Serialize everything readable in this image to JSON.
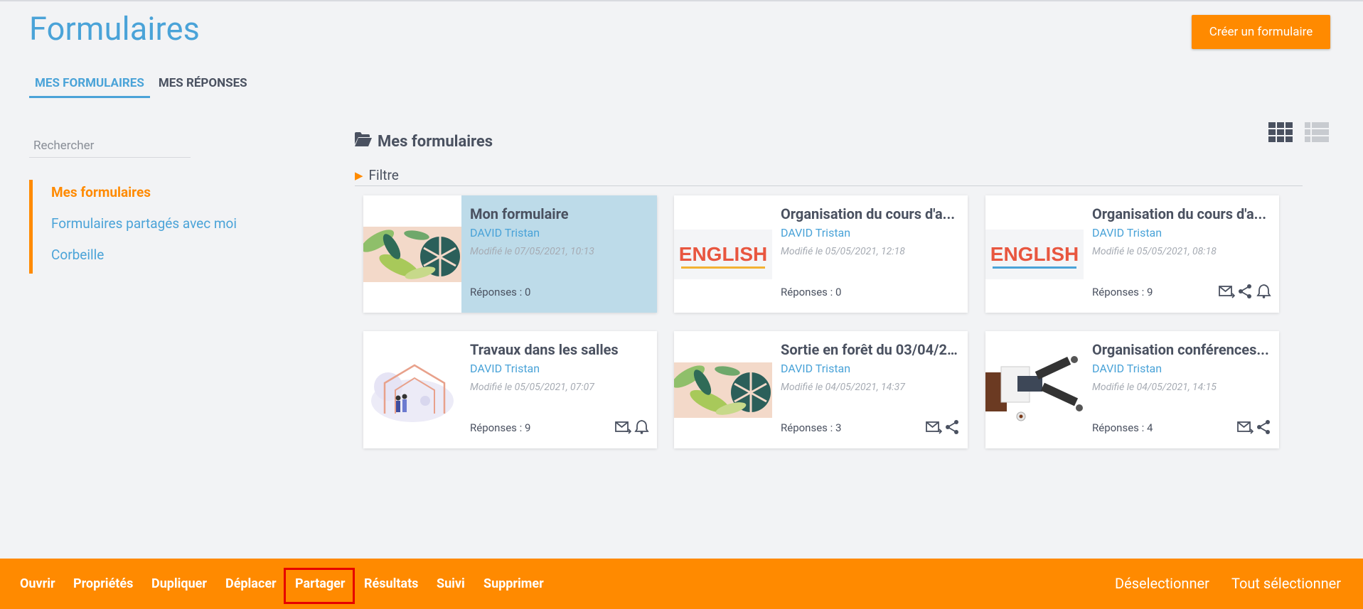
{
  "page": {
    "title": "Formulaires",
    "create_button": "Créer un formulaire"
  },
  "tabs": [
    {
      "label": "MES FORMULAIRES",
      "active": true
    },
    {
      "label": "MES RÉPONSES",
      "active": false
    }
  ],
  "search": {
    "placeholder": "Rechercher",
    "value": ""
  },
  "sidebar": {
    "items": [
      {
        "label": "Mes formulaires",
        "active": true
      },
      {
        "label": "Formulaires partagés avec moi",
        "active": false
      },
      {
        "label": "Corbeille",
        "active": false
      }
    ]
  },
  "main": {
    "section_title": "Mes formulaires",
    "filter_label": "Filtre",
    "view_modes": [
      "grid-view-icon",
      "list-view-icon"
    ],
    "cards": [
      {
        "title": "Mon formulaire",
        "author": "DAVID Tristan",
        "modified": "Modifié le 07/05/2021, 10:13",
        "responses": "Réponses : 0",
        "thumbnail": "tropical-leaves",
        "selected": true,
        "icons": []
      },
      {
        "title": "Organisation du cours d'a...",
        "author": "DAVID Tristan",
        "modified": "Modifié le 05/05/2021, 12:18",
        "responses": "Réponses : 0",
        "thumbnail": "english-word",
        "thumbnail_text": "ENGLISH",
        "selected": false,
        "icons": []
      },
      {
        "title": "Organisation du cours d'a...",
        "author": "DAVID Tristan",
        "modified": "Modifié le 05/05/2021, 08:18",
        "responses": "Réponses : 9",
        "thumbnail": "english-word",
        "thumbnail_text": "ENGLISH",
        "selected": false,
        "icons": [
          "mail-icon",
          "share-icon",
          "bell-icon"
        ]
      },
      {
        "title": "Travaux dans les salles",
        "author": "DAVID Tristan",
        "modified": "Modifié le 05/05/2021, 07:07",
        "responses": "Réponses : 9",
        "thumbnail": "house-illustration",
        "selected": false,
        "icons": [
          "mail-icon",
          "bell-icon"
        ]
      },
      {
        "title": "Sortie en forêt du 03/04/2...",
        "author": "DAVID Tristan",
        "modified": "Modifié le 04/05/2021, 14:37",
        "responses": "Réponses : 3",
        "thumbnail": "tropical-leaves",
        "selected": false,
        "icons": [
          "mail-icon",
          "share-icon"
        ]
      },
      {
        "title": "Organisation conférences...",
        "author": "DAVID Tristan",
        "modified": "Modifié le 04/05/2021, 14:15",
        "responses": "Réponses : 4",
        "thumbnail": "conference-illustration",
        "selected": false,
        "icons": [
          "mail-icon",
          "share-icon"
        ]
      }
    ]
  },
  "bottom_bar": {
    "actions": [
      "Ouvrir",
      "Propriétés",
      "Dupliquer",
      "Déplacer",
      "Partager",
      "Résultats",
      "Suivi",
      "Supprimer"
    ],
    "highlighted_action": "Partager",
    "right_actions": [
      "Déselectionner",
      "Tout sélectionner"
    ]
  },
  "colors": {
    "accent_blue": "#4aa3d8",
    "accent_orange": "#ff8a00",
    "selected_card": "#bddbe9",
    "highlight_red": "#e60000"
  }
}
